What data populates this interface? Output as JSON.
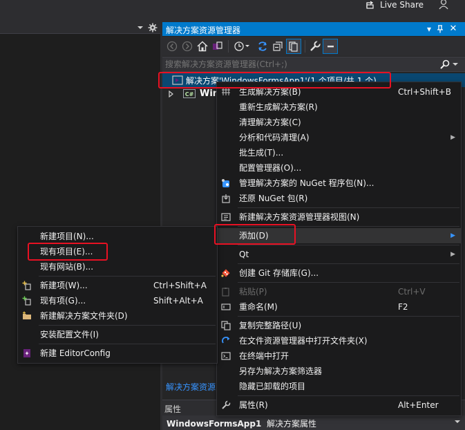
{
  "topbar": {
    "live_share": "Live Share"
  },
  "solution_explorer": {
    "title": "解决方案资源管理器",
    "title_buttons": [
      "▾",
      "⊓",
      "✕"
    ],
    "search_placeholder": "搜索解决方案资源管理器(Ctrl+;)",
    "tree": {
      "solution_label": "解决方案'WindowsFormsApp1'(1 个项目/共 1 个)",
      "project_badge": "C#",
      "project_label": "Win"
    },
    "footer_link": "解决方案资源",
    "properties_header": "属性",
    "properties_object": "WindowsFormsApp1",
    "properties_type": "解决方案属性"
  },
  "context_menu": {
    "items": [
      {
        "label": "生成解决方案(B)",
        "shortcut": "Ctrl+Shift+B",
        "icon": "build-icon"
      },
      {
        "label": "重新生成解决方案(R)",
        "shortcut": "",
        "icon": ""
      },
      {
        "label": "清理解决方案(C)",
        "shortcut": "",
        "icon": ""
      },
      {
        "label": "分析和代码清理(A)",
        "shortcut": "",
        "icon": "",
        "submenu": true
      },
      {
        "label": "批生成(T)...",
        "shortcut": "",
        "icon": ""
      },
      {
        "label": "配置管理器(O)...",
        "shortcut": "",
        "icon": ""
      },
      {
        "label": "管理解决方案的 NuGet 程序包(N)...",
        "shortcut": "",
        "icon": "nuget-icon"
      },
      {
        "label": "还原 NuGet 包(R)",
        "shortcut": "",
        "icon": "restore-icon"
      },
      {
        "label": "新建解决方案资源管理器视图(N)",
        "shortcut": "",
        "icon": "new-view-icon"
      },
      {
        "label": "添加(D)",
        "shortcut": "",
        "icon": "",
        "submenu": true
      },
      {
        "label": "Qt",
        "shortcut": "",
        "icon": "",
        "submenu": true
      },
      {
        "label": "创建 Git 存储库(G)...",
        "shortcut": "",
        "icon": "git-icon"
      },
      {
        "label": "粘贴(P)",
        "shortcut": "Ctrl+V",
        "icon": "paste-icon",
        "disabled": true
      },
      {
        "label": "重命名(M)",
        "shortcut": "F2",
        "icon": "rename-icon"
      },
      {
        "label": "复制完整路径(U)",
        "shortcut": "",
        "icon": "copy-icon"
      },
      {
        "label": "在文件资源管理器中打开文件夹(X)",
        "shortcut": "",
        "icon": "open-folder-icon"
      },
      {
        "label": "在终端中打开",
        "shortcut": "",
        "icon": "terminal-icon"
      },
      {
        "label": "另存为解决方案筛选器",
        "shortcut": "",
        "icon": ""
      },
      {
        "label": "隐藏已卸载的项目",
        "shortcut": "",
        "icon": ""
      },
      {
        "label": "属性(R)",
        "shortcut": "Alt+Enter",
        "icon": "wrench-icon"
      }
    ]
  },
  "add_submenu": {
    "items": [
      {
        "label": "新建项目(N)...",
        "shortcut": "",
        "icon": ""
      },
      {
        "label": "现有项目(E)...",
        "shortcut": "",
        "icon": ""
      },
      {
        "label": "现有网站(B)...",
        "shortcut": "",
        "icon": ""
      },
      {
        "label": "新建项(W)...",
        "shortcut": "Ctrl+Shift+A",
        "icon": "new-item-icon"
      },
      {
        "label": "现有项(G)...",
        "shortcut": "Shift+Alt+A",
        "icon": "existing-item-icon"
      },
      {
        "label": "新建解决方案文件夹(D)",
        "shortcut": "",
        "icon": "new-folder-icon"
      },
      {
        "label": "安装配置文件(I)",
        "shortcut": "",
        "icon": ""
      },
      {
        "label": "新建 EditorConfig",
        "shortcut": "",
        "icon": "editorconfig-icon"
      }
    ]
  },
  "colors": {
    "accent": "#007acc",
    "highlight_box": "#e81123",
    "background": "#1e1e1e",
    "panel": "#252526",
    "menu": "#1b1b1c"
  }
}
